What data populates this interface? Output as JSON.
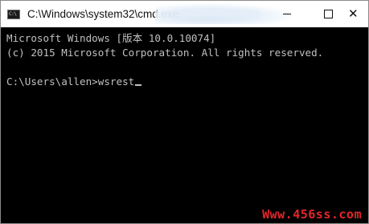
{
  "window": {
    "title": "C:\\Windows\\system32\\cmd.exe",
    "icon": "cmd-icon",
    "controls": {
      "minimize_icon": "minimize-icon",
      "maximize_icon": "maximize-icon",
      "close_icon": "close-icon",
      "close_glyph": "✕"
    }
  },
  "console": {
    "background": "#000000",
    "foreground": "#c0c0c0",
    "lines": [
      "Microsoft Windows [版本 10.0.10074]",
      "(c) 2015 Microsoft Corporation. All rights reserved."
    ],
    "prompt": "C:\\Users\\allen>",
    "command": "wsrest"
  },
  "watermark": {
    "text": "Www.456ss.com",
    "color": "#e3262b"
  }
}
